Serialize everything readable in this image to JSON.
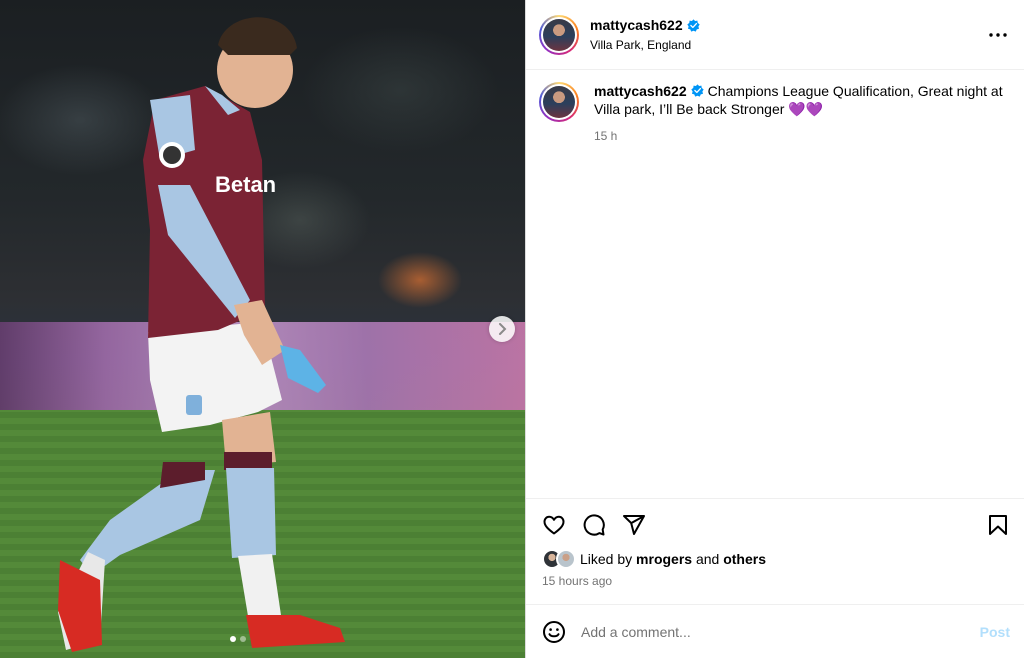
{
  "post": {
    "username": "mattycash622",
    "location": "Villa Park, England",
    "caption": "Champions League Qualification, Great night at Villa park, I’ll Be back Stronger 💜💜",
    "time": "15 h"
  },
  "media": {
    "description_icon": "photo",
    "carousel": {
      "current": 1,
      "total": 2
    }
  },
  "actions": {
    "like_icon": "heart-icon",
    "comment_icon": "comment-icon",
    "share_icon": "share-icon",
    "save_icon": "bookmark-icon"
  },
  "likes": {
    "prefix": "Liked by",
    "user": "mrogers",
    "and": "and",
    "others": "others"
  },
  "timestamp": "15 hours ago",
  "comment": {
    "placeholder": "Add a comment...",
    "post_label": "Post"
  },
  "colors": {
    "verified": "#0095f6",
    "post_disabled": "#b2dffc",
    "muted": "#737373"
  }
}
